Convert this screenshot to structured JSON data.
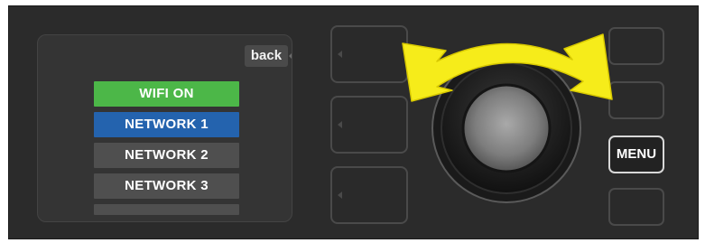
{
  "screen": {
    "back_label": "back",
    "items": [
      {
        "label": "WIFI ON",
        "state": "enabled",
        "color": "#4cb748"
      },
      {
        "label": "NETWORK 1",
        "state": "selected",
        "color": "#2463ae"
      },
      {
        "label": "NETWORK 2",
        "state": "normal",
        "color": "#4f4f4f"
      },
      {
        "label": "NETWORK 3",
        "state": "normal",
        "color": "#4f4f4f"
      }
    ]
  },
  "controls": {
    "menu_label": "MENU",
    "rotate_indicator": "double-arrow-icon",
    "arrow_color": "#f6ec1a"
  }
}
